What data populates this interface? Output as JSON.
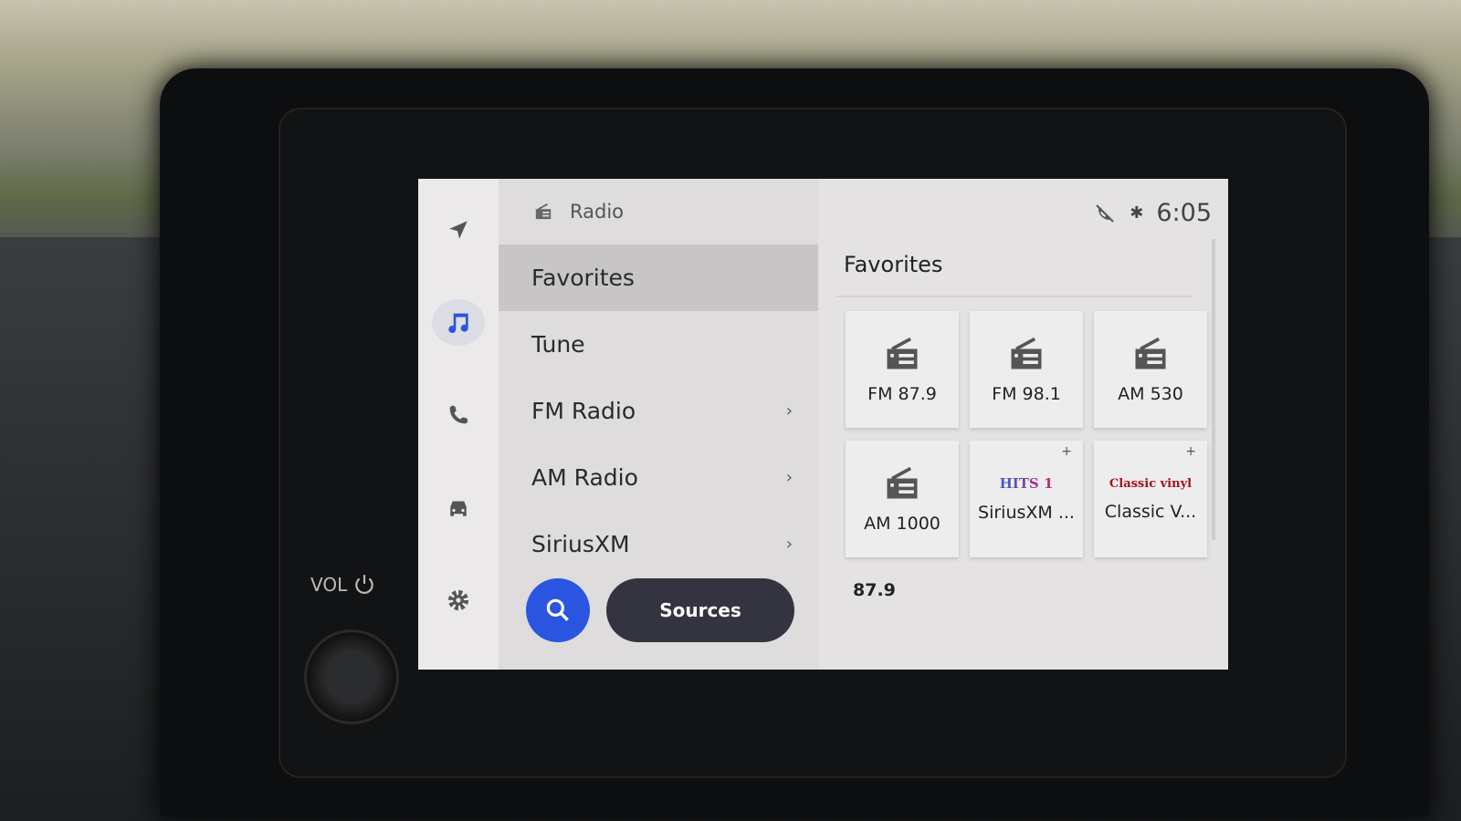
{
  "colors": {
    "accent": "#2a55e0",
    "sources_button": "#33343f",
    "selected_row": "#c8c5c6"
  },
  "rail": {
    "items": [
      {
        "name": "navigation",
        "icon": "navigation-arrow-icon"
      },
      {
        "name": "media",
        "icon": "music-note-icon",
        "active": true
      },
      {
        "name": "phone",
        "icon": "phone-icon"
      },
      {
        "name": "vehicle",
        "icon": "car-icon"
      },
      {
        "name": "settings",
        "icon": "gear-icon"
      }
    ]
  },
  "menu": {
    "header": {
      "icon": "radio-icon",
      "title": "Radio"
    },
    "items": [
      {
        "label": "Favorites",
        "selected": true,
        "chevron": false
      },
      {
        "label": "Tune",
        "chevron": false
      },
      {
        "label": "FM Radio",
        "chevron": true
      },
      {
        "label": "AM Radio",
        "chevron": true
      },
      {
        "label": "SiriusXM",
        "chevron": true
      }
    ],
    "chevron_glyph": "›",
    "search_icon": "search-icon",
    "sources_label": "Sources"
  },
  "status": {
    "icons": [
      "phone-no-signal-icon",
      "bluetooth-icon"
    ],
    "bluetooth_glyph": "✱",
    "time": "6:05"
  },
  "favorites": {
    "title": "Favorites",
    "tiles": [
      {
        "label": "FM 87.9",
        "icon": "radio-icon"
      },
      {
        "label": "FM 98.1",
        "icon": "radio-icon"
      },
      {
        "label": "AM 530",
        "icon": "radio-icon"
      },
      {
        "label": "AM 1000",
        "icon": "radio-icon"
      },
      {
        "label": "SiriusXM ...",
        "icon": "hits1-logo",
        "logo_text": "HITS 1",
        "add": "+"
      },
      {
        "label": "Classic V...",
        "icon": "classic-vinyl-logo",
        "logo_text": "Classic vinyl",
        "add": "+"
      }
    ],
    "now_playing": "87.9"
  },
  "hardware": {
    "vol_label": "VOL"
  }
}
